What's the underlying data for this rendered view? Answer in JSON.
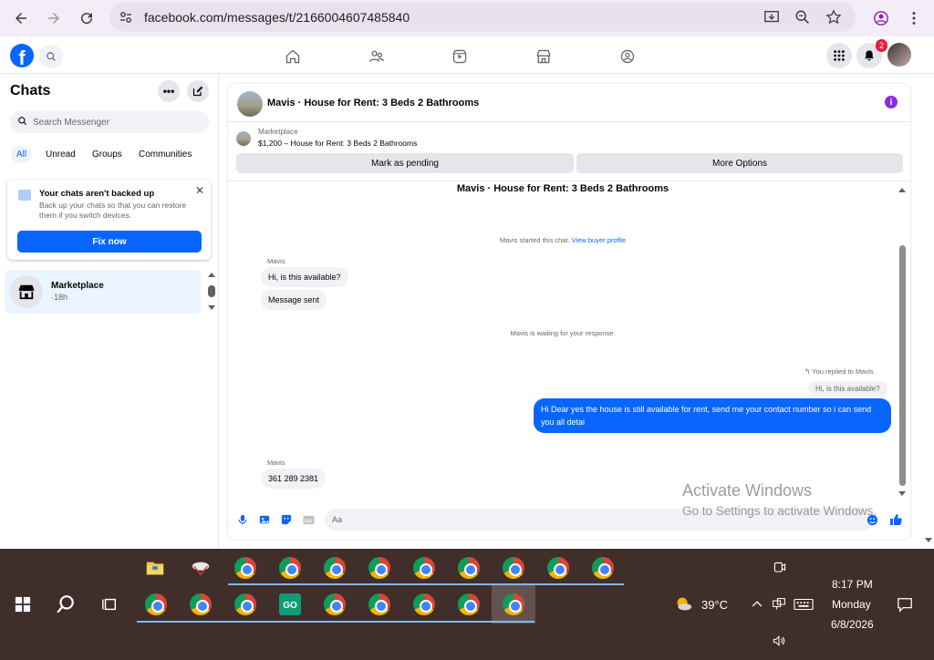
{
  "browser": {
    "url": "facebook.com/messages/t/2166004607485840"
  },
  "fb_header": {
    "notification_count": "2"
  },
  "sidebar": {
    "title": "Chats",
    "search_placeholder": "Search Messenger",
    "filters": [
      "All",
      "Unread",
      "Groups",
      "Communities"
    ],
    "active_filter": "All",
    "backup_card": {
      "title": "Your chats aren't backed up",
      "description": "Back up your chats so that you can restore them if you switch devices.",
      "button": "Fix now"
    },
    "conversations": [
      {
        "name": "Marketplace",
        "time": "·18h"
      }
    ]
  },
  "chat": {
    "title": "Mavis · House for Rent: 3 Beds 2 Bathrooms",
    "listing_source": "Marketplace",
    "listing_name": "$1,200 – House for Rent: 3 Beds 2 Bathrooms",
    "mark_pending_label": "Mark as pending",
    "more_options_label": "More Options",
    "thread_title": "Mavis · House for Rent: 3 Beds 2 Bathrooms",
    "started_text": "Mavis started this chat.",
    "view_buyer_profile": "View buyer profile",
    "sender_name": "Mavis",
    "msg1": "Hi, is this available?",
    "msg2": "Message sent",
    "waiting_text": "Mavis is waiting for your response.",
    "replied_label": "You replied to Mavis",
    "replied_quote": "Hi, is this available?",
    "my_reply": "Hi Dear yes the house is still available for rent, send me your contact number so i can send you all detai",
    "sender_name_2": "Mavis",
    "msg3": "361 289 2381",
    "composer_placeholder": "Aa"
  },
  "watermark": {
    "line1": "Activate Windows",
    "line2": "Go to Settings to activate Windows."
  },
  "taskbar": {
    "temperature": "39°C",
    "time": "8:17 PM",
    "day": "Monday",
    "date": "6/8/2026"
  },
  "colors": {
    "fb_blue": "#0866ff",
    "taskbar_bg": "#402e2a",
    "browser_bg": "#f3edf7"
  }
}
